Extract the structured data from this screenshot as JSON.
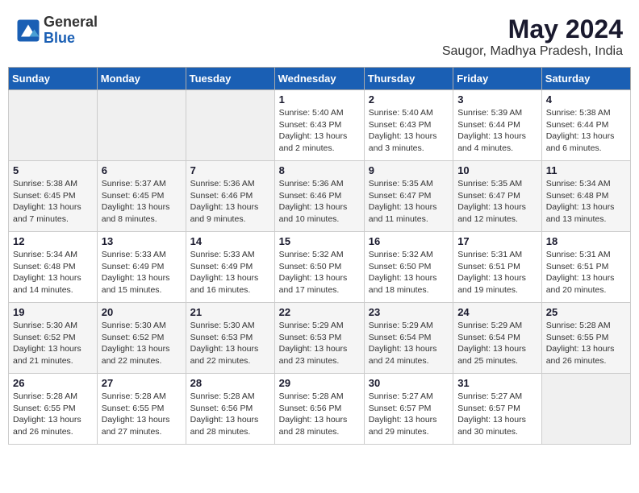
{
  "header": {
    "logo_general": "General",
    "logo_blue": "Blue",
    "month_year": "May 2024",
    "location": "Saugor, Madhya Pradesh, India"
  },
  "days_of_week": [
    "Sunday",
    "Monday",
    "Tuesday",
    "Wednesday",
    "Thursday",
    "Friday",
    "Saturday"
  ],
  "weeks": [
    [
      {
        "day": "",
        "info": ""
      },
      {
        "day": "",
        "info": ""
      },
      {
        "day": "",
        "info": ""
      },
      {
        "day": "1",
        "info": "Sunrise: 5:40 AM\nSunset: 6:43 PM\nDaylight: 13 hours\nand 2 minutes."
      },
      {
        "day": "2",
        "info": "Sunrise: 5:40 AM\nSunset: 6:43 PM\nDaylight: 13 hours\nand 3 minutes."
      },
      {
        "day": "3",
        "info": "Sunrise: 5:39 AM\nSunset: 6:44 PM\nDaylight: 13 hours\nand 4 minutes."
      },
      {
        "day": "4",
        "info": "Sunrise: 5:38 AM\nSunset: 6:44 PM\nDaylight: 13 hours\nand 6 minutes."
      }
    ],
    [
      {
        "day": "5",
        "info": "Sunrise: 5:38 AM\nSunset: 6:45 PM\nDaylight: 13 hours\nand 7 minutes."
      },
      {
        "day": "6",
        "info": "Sunrise: 5:37 AM\nSunset: 6:45 PM\nDaylight: 13 hours\nand 8 minutes."
      },
      {
        "day": "7",
        "info": "Sunrise: 5:36 AM\nSunset: 6:46 PM\nDaylight: 13 hours\nand 9 minutes."
      },
      {
        "day": "8",
        "info": "Sunrise: 5:36 AM\nSunset: 6:46 PM\nDaylight: 13 hours\nand 10 minutes."
      },
      {
        "day": "9",
        "info": "Sunrise: 5:35 AM\nSunset: 6:47 PM\nDaylight: 13 hours\nand 11 minutes."
      },
      {
        "day": "10",
        "info": "Sunrise: 5:35 AM\nSunset: 6:47 PM\nDaylight: 13 hours\nand 12 minutes."
      },
      {
        "day": "11",
        "info": "Sunrise: 5:34 AM\nSunset: 6:48 PM\nDaylight: 13 hours\nand 13 minutes."
      }
    ],
    [
      {
        "day": "12",
        "info": "Sunrise: 5:34 AM\nSunset: 6:48 PM\nDaylight: 13 hours\nand 14 minutes."
      },
      {
        "day": "13",
        "info": "Sunrise: 5:33 AM\nSunset: 6:49 PM\nDaylight: 13 hours\nand 15 minutes."
      },
      {
        "day": "14",
        "info": "Sunrise: 5:33 AM\nSunset: 6:49 PM\nDaylight: 13 hours\nand 16 minutes."
      },
      {
        "day": "15",
        "info": "Sunrise: 5:32 AM\nSunset: 6:50 PM\nDaylight: 13 hours\nand 17 minutes."
      },
      {
        "day": "16",
        "info": "Sunrise: 5:32 AM\nSunset: 6:50 PM\nDaylight: 13 hours\nand 18 minutes."
      },
      {
        "day": "17",
        "info": "Sunrise: 5:31 AM\nSunset: 6:51 PM\nDaylight: 13 hours\nand 19 minutes."
      },
      {
        "day": "18",
        "info": "Sunrise: 5:31 AM\nSunset: 6:51 PM\nDaylight: 13 hours\nand 20 minutes."
      }
    ],
    [
      {
        "day": "19",
        "info": "Sunrise: 5:30 AM\nSunset: 6:52 PM\nDaylight: 13 hours\nand 21 minutes."
      },
      {
        "day": "20",
        "info": "Sunrise: 5:30 AM\nSunset: 6:52 PM\nDaylight: 13 hours\nand 22 minutes."
      },
      {
        "day": "21",
        "info": "Sunrise: 5:30 AM\nSunset: 6:53 PM\nDaylight: 13 hours\nand 22 minutes."
      },
      {
        "day": "22",
        "info": "Sunrise: 5:29 AM\nSunset: 6:53 PM\nDaylight: 13 hours\nand 23 minutes."
      },
      {
        "day": "23",
        "info": "Sunrise: 5:29 AM\nSunset: 6:54 PM\nDaylight: 13 hours\nand 24 minutes."
      },
      {
        "day": "24",
        "info": "Sunrise: 5:29 AM\nSunset: 6:54 PM\nDaylight: 13 hours\nand 25 minutes."
      },
      {
        "day": "25",
        "info": "Sunrise: 5:28 AM\nSunset: 6:55 PM\nDaylight: 13 hours\nand 26 minutes."
      }
    ],
    [
      {
        "day": "26",
        "info": "Sunrise: 5:28 AM\nSunset: 6:55 PM\nDaylight: 13 hours\nand 26 minutes."
      },
      {
        "day": "27",
        "info": "Sunrise: 5:28 AM\nSunset: 6:55 PM\nDaylight: 13 hours\nand 27 minutes."
      },
      {
        "day": "28",
        "info": "Sunrise: 5:28 AM\nSunset: 6:56 PM\nDaylight: 13 hours\nand 28 minutes."
      },
      {
        "day": "29",
        "info": "Sunrise: 5:28 AM\nSunset: 6:56 PM\nDaylight: 13 hours\nand 28 minutes."
      },
      {
        "day": "30",
        "info": "Sunrise: 5:27 AM\nSunset: 6:57 PM\nDaylight: 13 hours\nand 29 minutes."
      },
      {
        "day": "31",
        "info": "Sunrise: 5:27 AM\nSunset: 6:57 PM\nDaylight: 13 hours\nand 30 minutes."
      },
      {
        "day": "",
        "info": ""
      }
    ]
  ]
}
